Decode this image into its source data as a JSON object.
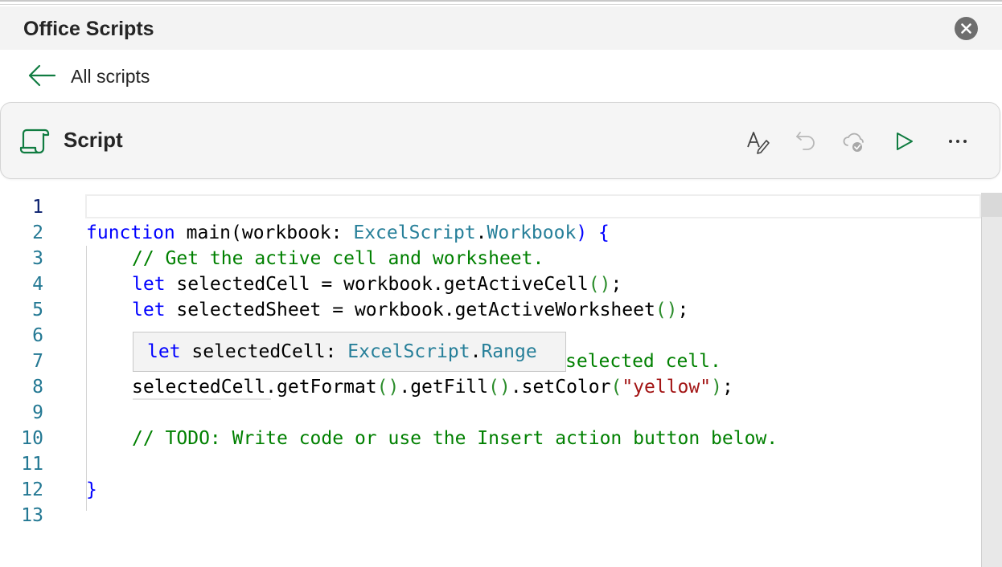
{
  "pane": {
    "title": "Office Scripts",
    "close_icon": "close-icon"
  },
  "nav": {
    "back_label": "All scripts",
    "back_icon": "arrow-left-icon"
  },
  "script": {
    "name": "Script",
    "icon": "script-scroll-icon",
    "toolbar": {
      "format_icon": "format-code-icon",
      "undo_icon": "undo-icon",
      "save_icon": "cloud-saved-icon",
      "run_icon": "run-play-icon",
      "more_icon": "more-ellipsis-icon"
    }
  },
  "editor": {
    "line_numbers": [
      "1",
      "2",
      "3",
      "4",
      "5",
      "6",
      "7",
      "8",
      "9",
      "10",
      "11",
      "12",
      "13"
    ],
    "lines": {
      "l2": {
        "kw": "function",
        "fn": " main(workbook: ",
        "ty1": "ExcelScript",
        "dot": ".",
        "ty2": "Workbook",
        "close": ") {"
      },
      "l3": {
        "comment": "// Get the active cell and worksheet."
      },
      "l4": {
        "kw": "let",
        "rest": " selectedCell = workbook.getActiveCell",
        "paren": "()",
        "end": ";"
      },
      "l5": {
        "kw": "let",
        "rest": " selectedSheet = workbook.getActiveWorksheet",
        "paren": "()",
        "end": ";"
      },
      "l7": {
        "comment_visible": "selected cell."
      },
      "l8": {
        "p1": "selectedCell.getFormat",
        "paren1": "()",
        "p2": ".getFill",
        "paren2": "()",
        "p3": ".setColor",
        "paren3": "(",
        "str": "\"yellow\"",
        "paren4": ")",
        "end": ";"
      },
      "l10": {
        "comment": "// TODO: Write code or use the Insert action button below."
      },
      "l12": {
        "brace": "}"
      }
    },
    "hover": {
      "kw": "let",
      "name": " selectedCell: ",
      "ty1": "ExcelScript",
      "dot": ".",
      "ty2": "Range"
    }
  }
}
